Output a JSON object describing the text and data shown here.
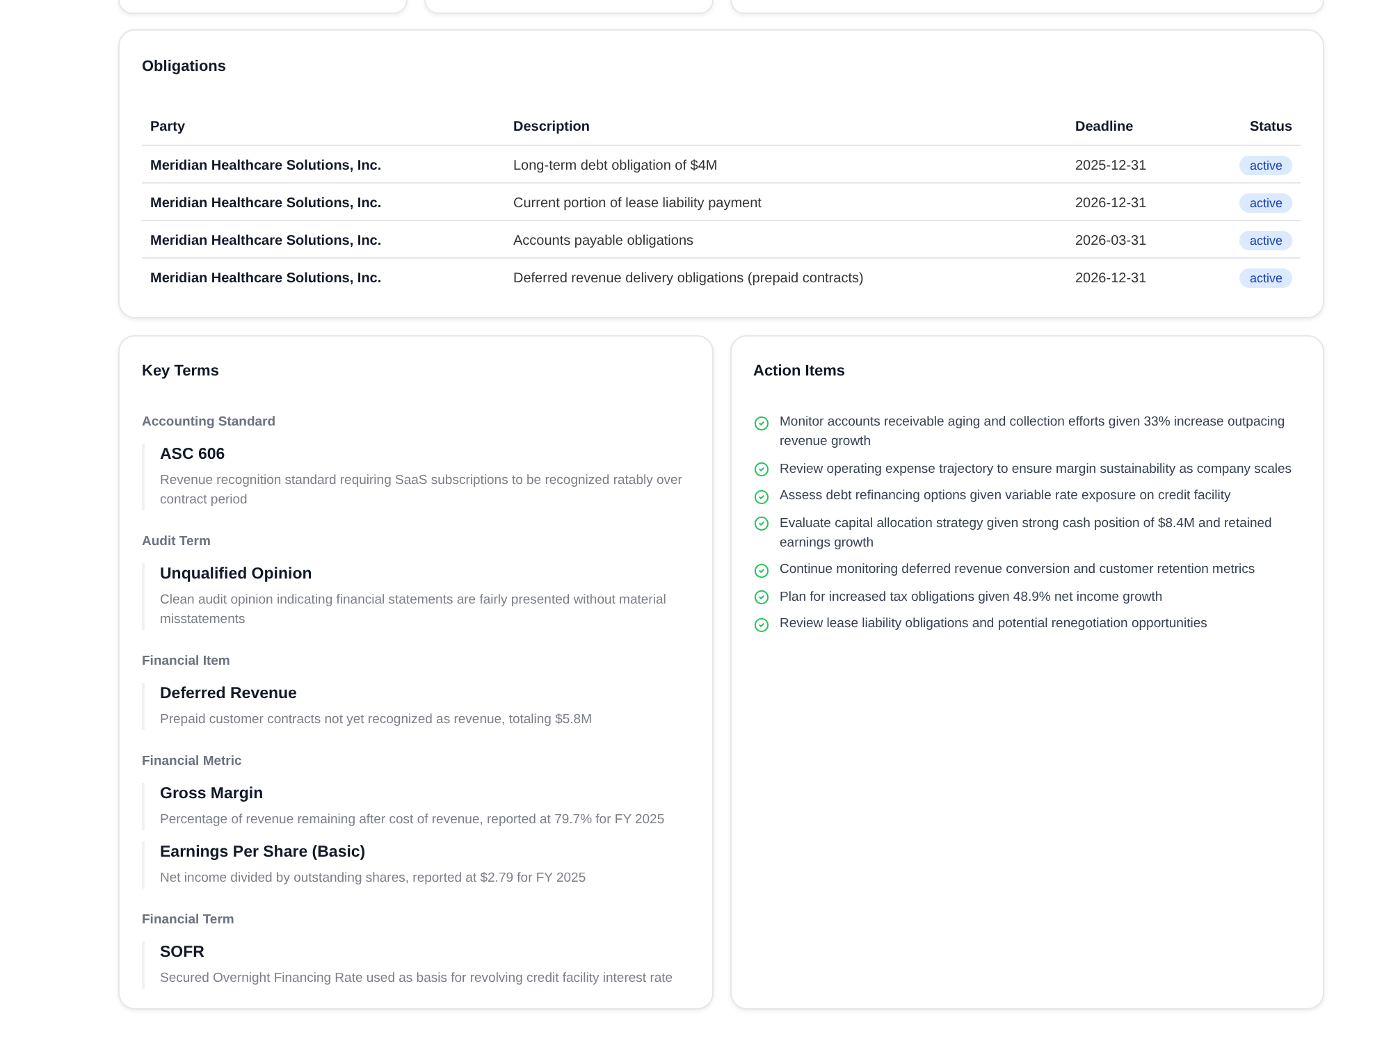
{
  "obligations": {
    "title": "Obligations",
    "columns": [
      "Party",
      "Description",
      "Deadline",
      "Status"
    ],
    "rows": [
      {
        "party": "Meridian Healthcare Solutions, Inc.",
        "description": "Long-term debt obligation of $4M",
        "deadline": "2025-12-31",
        "status": "active"
      },
      {
        "party": "Meridian Healthcare Solutions, Inc.",
        "description": "Current portion of lease liability payment",
        "deadline": "2026-12-31",
        "status": "active"
      },
      {
        "party": "Meridian Healthcare Solutions, Inc.",
        "description": "Accounts payable obligations",
        "deadline": "2026-03-31",
        "status": "active"
      },
      {
        "party": "Meridian Healthcare Solutions, Inc.",
        "description": "Deferred revenue delivery obligations (prepaid contracts)",
        "deadline": "2026-12-31",
        "status": "active"
      }
    ]
  },
  "key_terms": {
    "title": "Key Terms",
    "groups": [
      {
        "category": "Accounting Standard",
        "terms": [
          {
            "name": "ASC 606",
            "description": "Revenue recognition standard requiring SaaS subscriptions to be recognized ratably over contract period"
          }
        ]
      },
      {
        "category": "Audit Term",
        "terms": [
          {
            "name": "Unqualified Opinion",
            "description": "Clean audit opinion indicating financial statements are fairly presented without material misstatements"
          }
        ]
      },
      {
        "category": "Financial Item",
        "terms": [
          {
            "name": "Deferred Revenue",
            "description": "Prepaid customer contracts not yet recognized as revenue, totaling $5.8M"
          }
        ]
      },
      {
        "category": "Financial Metric",
        "terms": [
          {
            "name": "Gross Margin",
            "description": "Percentage of revenue remaining after cost of revenue, reported at 79.7% for FY 2025"
          },
          {
            "name": "Earnings Per Share (Basic)",
            "description": "Net income divided by outstanding shares, reported at $2.79 for FY 2025"
          }
        ]
      },
      {
        "category": "Financial Term",
        "terms": [
          {
            "name": "SOFR",
            "description": "Secured Overnight Financing Rate used as basis for revolving credit facility interest rate"
          }
        ]
      }
    ]
  },
  "action_items": {
    "title": "Action Items",
    "items": [
      "Monitor accounts receivable aging and collection efforts given 33% increase outpacing revenue growth",
      "Review operating expense trajectory to ensure margin sustainability as company scales",
      "Assess debt refinancing options given variable rate exposure on credit facility",
      "Evaluate capital allocation strategy given strong cash position of $8.4M and retained earnings growth",
      "Continue monitoring deferred revenue conversion and customer retention metrics",
      "Plan for increased tax obligations given 48.9% net income growth",
      "Review lease liability obligations and potential renegotiation opportunities"
    ]
  }
}
